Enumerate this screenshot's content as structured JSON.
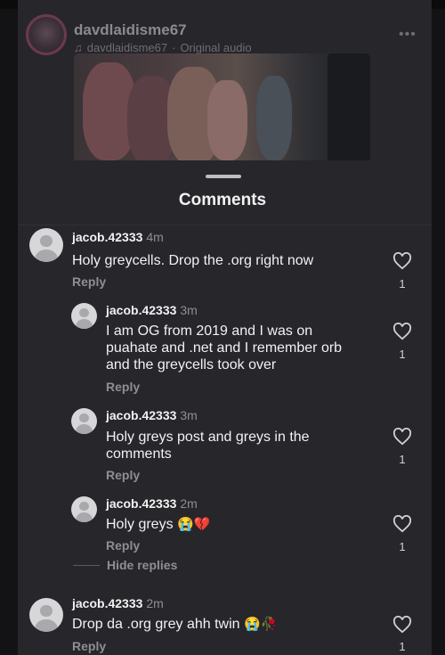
{
  "reel": {
    "username": "davdlaidisme67",
    "audio_author": "davdlaidisme67",
    "audio_separator": "·",
    "audio_label": "Original audio",
    "more_label": "•••"
  },
  "sheet": {
    "title": "Comments",
    "hide_replies_label": "Hide replies"
  },
  "comments": [
    {
      "username": "jacob.42333",
      "time": "4m",
      "text": "Holy greycells. Drop the .org right now",
      "reply_label": "Reply",
      "likes": "1"
    },
    {
      "username": "jacob.42333",
      "time": "3m",
      "text_lines": [
        "I am OG from 2019 and I was on",
        "puahate and .net and I remember orb",
        "and the greycells took over"
      ],
      "reply_label": "Reply",
      "likes": "1"
    },
    {
      "username": "jacob.42333",
      "time": "3m",
      "text_lines": [
        "Holy greys post and greys in the",
        "comments"
      ],
      "reply_label": "Reply",
      "likes": "1"
    },
    {
      "username": "jacob.42333",
      "time": "2m",
      "text": "Holy greys",
      "emoji": "😭💔",
      "reply_label": "Reply",
      "likes": "1"
    },
    {
      "username": "jacob.42333",
      "time": "2m",
      "text": "Drop da .org grey ahh twin",
      "emoji": "😭🥀",
      "reply_label": "Reply",
      "likes": "1"
    }
  ],
  "icons": {
    "heart": "heart-outline-icon",
    "note": "music-note-icon",
    "more": "more-dots-icon"
  },
  "colors": {
    "sheet_bg": "#26262b",
    "text_primary": "#f2f2f2",
    "text_secondary": "#8e8e93"
  }
}
